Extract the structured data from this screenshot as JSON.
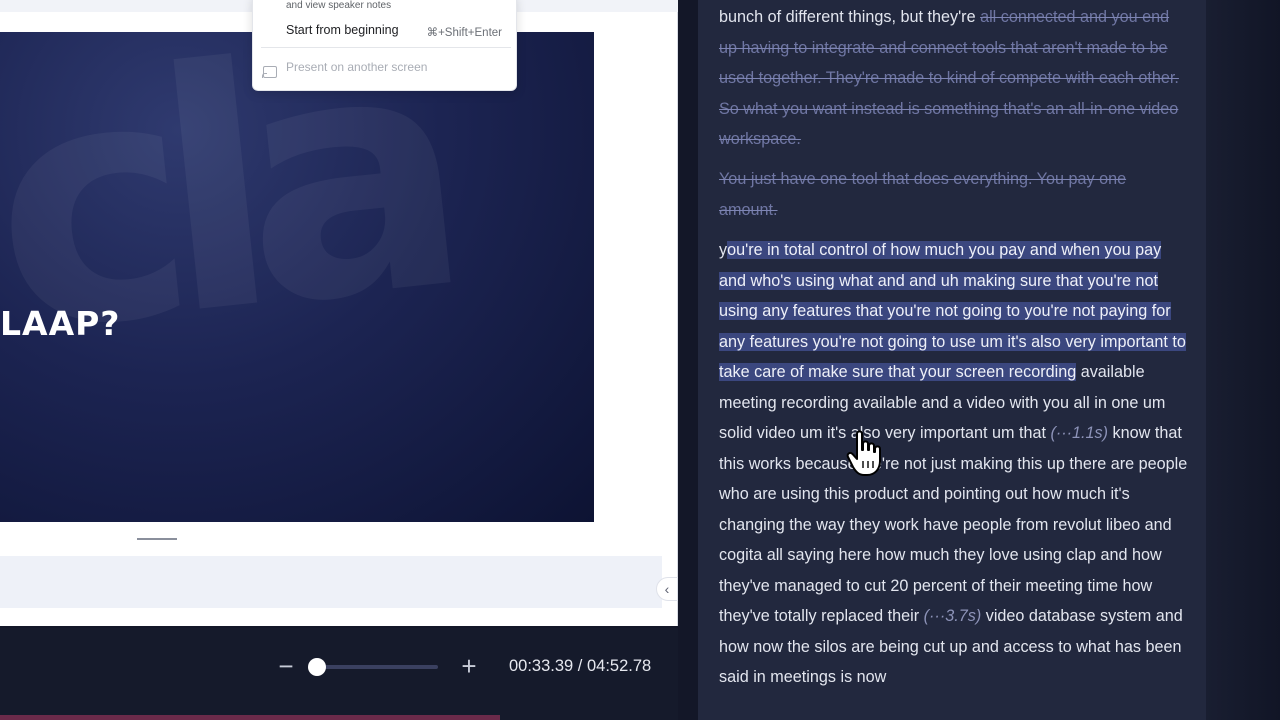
{
  "slide": {
    "title": "LAAP?",
    "watermark": "cla"
  },
  "present_menu": {
    "speaker_notes_caption": "and view speaker notes",
    "start_from_beginning": "Start from beginning",
    "start_shortcut": "⌘+Shift+Enter",
    "present_on_another_screen": "Present on another screen",
    "cast_icon": "cast-screen-icon"
  },
  "sidebar_toggle": "‹",
  "player": {
    "zoom_out": "−",
    "zoom_in": "+",
    "zoom_level": 0.05,
    "timecode": "00:33.39 / 04:52.78"
  },
  "transcript": {
    "p1": {
      "normal": "bunch of different things, but they're ",
      "struck": "all connected and you end up having to integrate and connect tools that aren't made to be used together. They're made to kind of compete with each other. So what you want instead is something that's an all-in-one video workspace."
    },
    "p2": {
      "struck": "You just have one tool that does everything. You pay one amount."
    },
    "p3": {
      "first_char": "y",
      "highlighted": "ou're in total control of how much you pay and when you pay and who's using what and and uh making sure that you're not using any features that you're not going to you're not paying for any features you're not going to use um it's also very important to take care of make sure that your screen recording",
      "after_highlight": " available meeting recording available and a video with you all in one um solid video um it's also very important um that",
      "pause_1": "(···1.1s)",
      "middle": " know that this works because we're not just making this up there are people who are using this product and pointing out how much it's changing the way they work have people from revolut libeo and cogita all saying here how much they love using clap and how they've managed to cut 20 percent of their meeting time how they've totally replaced their",
      "pause_2": "(···3.7s)",
      "end": " video database system and how now the silos are being cut up and access to what has been said in meetings is now"
    }
  },
  "colors": {
    "panel_bg": "#22283e",
    "highlight": "#3b477f",
    "struck_text": "#6f76a3",
    "slide_bg": "#1c2452"
  }
}
